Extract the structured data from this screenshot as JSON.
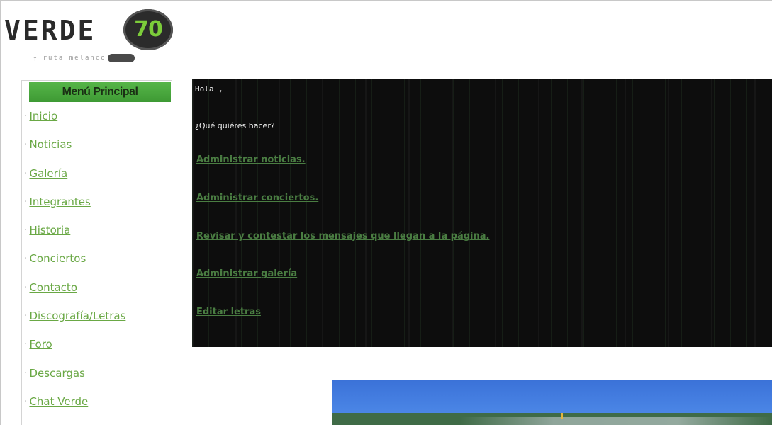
{
  "logo": {
    "wordmark": "VERDE",
    "badge_number": "70",
    "tagline": "ruta melanco",
    "icon": "arrow-up-icon",
    "badge_bg": "#2b2b2b",
    "badge_fg": "#7ccc3a"
  },
  "sidebar": {
    "title": "Menú Principal",
    "header_color": "#4aa83e",
    "link_color": "#6aa845",
    "bullet": "·",
    "items": [
      {
        "label": "Inicio"
      },
      {
        "label": "Noticias"
      },
      {
        "label": "Galería"
      },
      {
        "label": "Integrantes"
      },
      {
        "label": "Historia"
      },
      {
        "label": "Conciertos"
      },
      {
        "label": "Contacto"
      },
      {
        "label": "Discografía/Letras"
      },
      {
        "label": "Foro"
      },
      {
        "label": "Descargas"
      },
      {
        "label": "Chat Verde"
      }
    ]
  },
  "main": {
    "greeting": "Hola ,",
    "question": "¿Qué quiéres hacer?",
    "background": "#0d0d0d",
    "link_color": "#4a7d42",
    "actions": [
      {
        "label": "Administrar noticias."
      },
      {
        "label": "Administrar conciertos."
      },
      {
        "label": "Revisar y contestar los mensajes que llegan a la página."
      },
      {
        "label": "Administrar galería"
      },
      {
        "label": "Editar letras"
      }
    ]
  },
  "banner_image": {
    "sky_color": "#3b72d8",
    "ground_color": "#3f6b47",
    "icon": "road-landscape-image"
  }
}
